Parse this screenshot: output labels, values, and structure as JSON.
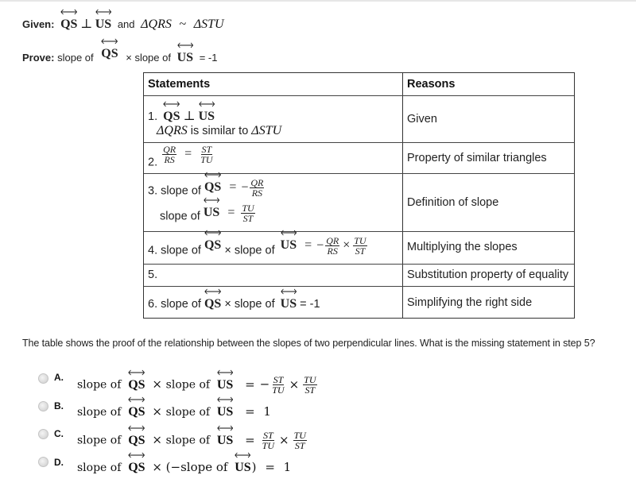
{
  "given": {
    "label": "Given:",
    "line1": "QS",
    "perp": "⊥",
    "line2": "US",
    "and": "and",
    "tri1": "ΔQRS",
    "similar": "~",
    "tri2": "ΔSTU"
  },
  "prove": {
    "label": "Prove:",
    "slope_of_1": "slope of",
    "line1": "QS",
    "times_slope_of": "× slope of",
    "line2": "US",
    "equals": "= -1"
  },
  "table": {
    "headers": [
      "Statements",
      "Reasons"
    ],
    "rows": [
      {
        "num": "1.",
        "statement_line1": {
          "a": "QS",
          "perp": "⊥",
          "b": "US"
        },
        "statement_line2": {
          "tri1": "ΔQRS",
          "text": "is similar to",
          "tri2": "ΔSTU"
        },
        "reason": "Given"
      },
      {
        "num": "2.",
        "statement": {
          "lhs_num": "QR",
          "lhs_den": "RS",
          "eq": "=",
          "rhs_num": "ST",
          "rhs_den": "TU"
        },
        "reason": "Property of similar triangles"
      },
      {
        "num": "3.",
        "statement_line1": {
          "text": "slope of",
          "line": "QS",
          "eq": "=",
          "sign": "−",
          "num": "QR",
          "den": "RS"
        },
        "statement_line2": {
          "text": "slope of",
          "line": "US",
          "eq": "=",
          "num": "TU",
          "den": "ST"
        },
        "reason": "Definition of slope"
      },
      {
        "num": "4.",
        "statement": {
          "text1": "slope of",
          "line1": "QS",
          "times": "× slope of",
          "line2": "US",
          "eq": "=",
          "sign": "−",
          "f1_num": "QR",
          "f1_den": "RS",
          "x": "×",
          "f2_num": "TU",
          "f2_den": "ST"
        },
        "reason": "Multiplying the slopes"
      },
      {
        "num": "5.",
        "statement": "",
        "reason": "Substitution property of equality"
      },
      {
        "num": "6.",
        "statement": {
          "text1": "slope of",
          "line1": "QS",
          "times": "× slope of",
          "line2": "US",
          "eq": "= -1"
        },
        "reason": "Simplifying the right side"
      }
    ]
  },
  "question": "The table shows the proof of the relationship between the slopes of two perpendicular lines. What is the missing statement in step 5?",
  "options": [
    {
      "label": "A.",
      "slope_of": "slope of",
      "line1": "QS",
      "times": "×",
      "slope_of_2": "slope of",
      "line2": "US",
      "eq": "=",
      "sign": "−",
      "f1_num": "ST",
      "f1_den": "TU",
      "x": "×",
      "f2_num": "TU",
      "f2_den": "ST"
    },
    {
      "label": "B.",
      "slope_of": "slope of",
      "line1": "QS",
      "times": "×",
      "slope_of_2": "slope of",
      "line2": "US",
      "eq": "= 1"
    },
    {
      "label": "C.",
      "slope_of": "slope of",
      "line1": "QS",
      "times": "×",
      "slope_of_2": "slope of",
      "line2": "US",
      "eq": "=",
      "f1_num": "ST",
      "f1_den": "TU",
      "x": "×",
      "f2_num": "TU",
      "f2_den": "ST"
    },
    {
      "label": "D.",
      "slope_of": "slope of",
      "line1": "QS",
      "times": "× (−slope of",
      "line2": "US",
      "close": ")",
      "eq": "= 1"
    }
  ]
}
